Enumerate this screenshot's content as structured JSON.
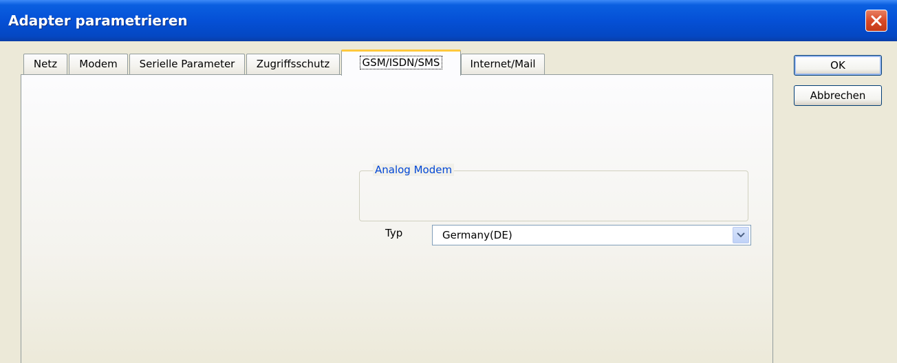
{
  "window": {
    "title": "Adapter parametrieren"
  },
  "tabs": [
    {
      "label": "Netz"
    },
    {
      "label": "Modem"
    },
    {
      "label": "Serielle Parameter"
    },
    {
      "label": "Zugriffsschutz"
    },
    {
      "label": "GSM/ISDN/SMS",
      "active": true
    },
    {
      "label": "Internet/Mail"
    }
  ],
  "group": {
    "legend": "Analog Modem",
    "typ_label": "Typ",
    "typ_value": "Germany(DE)"
  },
  "buttons": {
    "ok": "OK",
    "cancel": "Abbrechen"
  },
  "colors": {
    "title_bar": "#0550d6",
    "legend_text": "#0046d5",
    "active_tab_highlight": "#ffc83c",
    "close_button": "#d84a28"
  },
  "icons": {
    "close": "close-icon",
    "dropdown": "chevron-down-icon"
  }
}
